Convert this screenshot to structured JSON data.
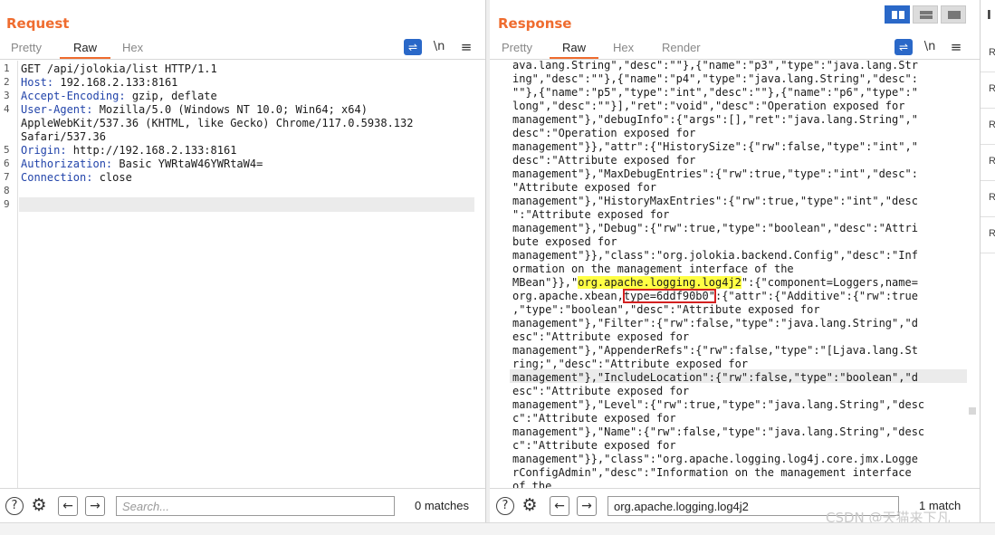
{
  "request": {
    "title": "Request",
    "tabs": [
      "Pretty",
      "Raw",
      "Hex"
    ],
    "active_tab": "Raw",
    "lines": [
      {
        "n": "1",
        "key": "",
        "rest": "GET /api/jolokia/list HTTP/1.1"
      },
      {
        "n": "2",
        "key": "Host:",
        "rest": " 192.168.2.133:8161"
      },
      {
        "n": "3",
        "key": "Accept-Encoding:",
        "rest": " gzip, deflate"
      },
      {
        "n": "4",
        "key": "User-Agent:",
        "rest": " Mozilla/5.0 (Windows NT 10.0; Win64; x64)"
      },
      {
        "n": "",
        "key": "",
        "rest": "AppleWebKit/537.36 (KHTML, like Gecko) Chrome/117.0.5938.132"
      },
      {
        "n": "",
        "key": "",
        "rest": "Safari/537.36"
      },
      {
        "n": "5",
        "key": "Origin:",
        "rest": " http://192.168.2.133:8161"
      },
      {
        "n": "6",
        "key": "Authorization:",
        "rest": " Basic YWRtaW46YWRtaW4="
      },
      {
        "n": "7",
        "key": "Connection:",
        "rest": " close"
      },
      {
        "n": "8",
        "key": "",
        "rest": ""
      },
      {
        "n": "9",
        "key": "",
        "rest": ""
      }
    ],
    "search": {
      "placeholder": "Search...",
      "value": "",
      "matches": "0 matches"
    }
  },
  "response": {
    "title": "Response",
    "tabs": [
      "Pretty",
      "Raw",
      "Hex",
      "Render"
    ],
    "active_tab": "Raw",
    "lines": [
      "ava.lang.String\",\"desc\":\"\"},{\"name\":\"p3\",\"type\":\"java.lang.Str",
      "ing\",\"desc\":\"\"},{\"name\":\"p4\",\"type\":\"java.lang.String\",\"desc\":",
      "\"\"},{\"name\":\"p5\",\"type\":\"int\",\"desc\":\"\"},{\"name\":\"p6\",\"type\":\"",
      "long\",\"desc\":\"\"}],\"ret\":\"void\",\"desc\":\"Operation exposed for",
      "management\"},\"debugInfo\":{\"args\":[],\"ret\":\"java.lang.String\",\"",
      "desc\":\"Operation exposed for",
      "management\"}},\"attr\":{\"HistorySize\":{\"rw\":false,\"type\":\"int\",\"",
      "desc\":\"Attribute exposed for",
      "management\"},\"MaxDebugEntries\":{\"rw\":true,\"type\":\"int\",\"desc\":",
      "\"Attribute exposed for",
      "management\"},\"HistoryMaxEntries\":{\"rw\":true,\"type\":\"int\",\"desc",
      "\":\"Attribute exposed for",
      "management\"},\"Debug\":{\"rw\":true,\"type\":\"boolean\",\"desc\":\"Attri",
      "bute exposed for",
      "management\"}},\"class\":\"org.jolokia.backend.Config\",\"desc\":\"Inf",
      "ormation on the management interface of the",
      "__HL1__",
      "__HL2__",
      ",\"type\":\"boolean\",\"desc\":\"Attribute exposed for",
      "management\"},\"Filter\":{\"rw\":false,\"type\":\"java.lang.String\",\"d",
      "esc\":\"Attribute exposed for",
      "management\"},\"AppenderRefs\":{\"rw\":false,\"type\":\"[Ljava.lang.St",
      "ring;\",\"desc\":\"Attribute exposed for",
      "management\"},\"IncludeLocation\":{\"rw\":false,\"type\":\"boolean\",\"d",
      "esc\":\"Attribute exposed for",
      "management\"},\"Level\":{\"rw\":true,\"type\":\"java.lang.String\",\"desc",
      "c\":\"Attribute exposed for",
      "management\"},\"Name\":{\"rw\":false,\"type\":\"java.lang.String\",\"desc",
      "c\":\"Attribute exposed for",
      "management\"}},\"class\":\"org.apache.logging.log4j.core.jmx.Logge",
      "rConfigAdmin\",\"desc\":\"Information on the management interface",
      "of the"
    ],
    "hl_line1": {
      "pre": "MBean\"}},\"",
      "mark": "org.apache.logging.log4j2",
      "post": "\":{\"component=Loggers,name="
    },
    "hl_line2": {
      "pre": "org.apache.xbean,",
      "box": "type=6ddf90b0\"",
      "post": ":{\"attr\":{\"Additive\":{\"rw\":true"
    },
    "search": {
      "value": "org.apache.logging.log4j2",
      "matches": "1 match"
    }
  },
  "side": {
    "top_label": "I",
    "items": [
      "R",
      "R",
      "R",
      "R",
      "R",
      "R"
    ]
  },
  "watermark": "CSDN @天猫来下凡",
  "icons": {
    "help": "?",
    "settings": "⚙",
    "back": "←",
    "forward": "→",
    "wrap": "⇌",
    "newline": "\\n",
    "menu": "≡"
  }
}
